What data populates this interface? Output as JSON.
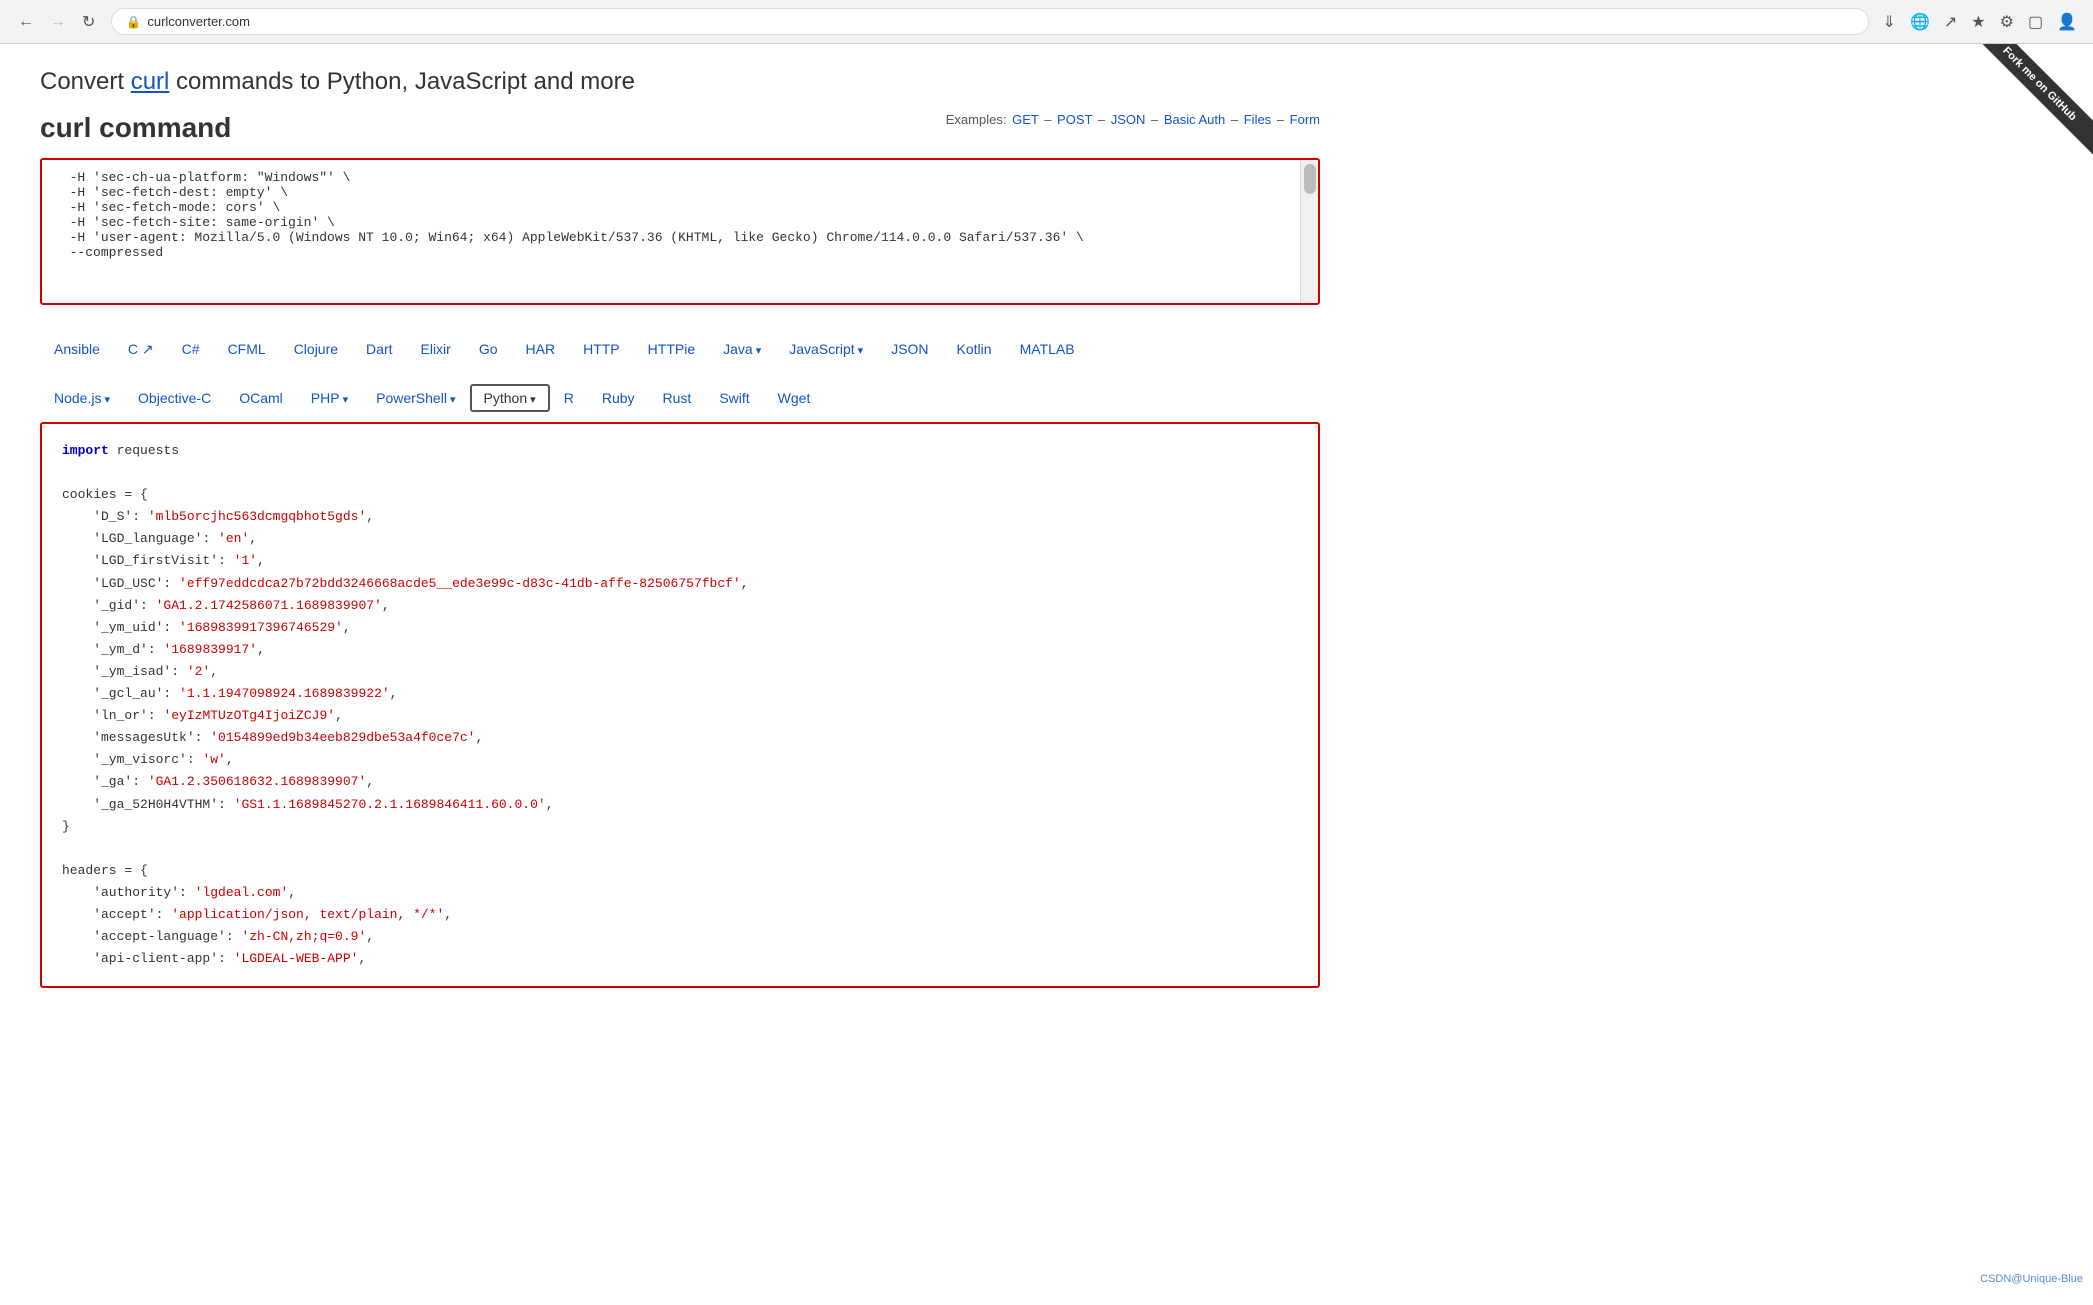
{
  "browser": {
    "url": "curlconverter.com",
    "back_disabled": false,
    "forward_disabled": true
  },
  "page": {
    "title_prefix": "Convert ",
    "title_link": "curl",
    "title_suffix": " commands to Python, JavaScript and more",
    "section_label": "curl command",
    "examples_label": "Examples:",
    "examples_links": [
      "GET",
      "POST",
      "JSON",
      "Basic Auth",
      "Files",
      "Form"
    ],
    "examples_separator": " – "
  },
  "curl_input": {
    "content": "  -H 'sec-ch-ua-platform: \"Windows\"' \\\n  -H 'sec-fetch-dest: empty' \\\n  -H 'sec-fetch-mode: cors' \\\n  -H 'sec-fetch-site: same-origin' \\\n  -H 'user-agent: Mozilla/5.0 (Windows NT 10.0; Win64; x64) AppleWebKit/537.36 (KHTML, like Gecko) Chrome/114.0.0.0 Safari/537.36' \\\n  --compressed"
  },
  "languages": {
    "row1": [
      {
        "label": "Ansible",
        "id": "ansible"
      },
      {
        "label": "C",
        "id": "c",
        "ext": true
      },
      {
        "label": "C#",
        "id": "csharp"
      },
      {
        "label": "CFML",
        "id": "cfml"
      },
      {
        "label": "Clojure",
        "id": "clojure"
      },
      {
        "label": "Dart",
        "id": "dart"
      },
      {
        "label": "Elixir",
        "id": "elixir"
      },
      {
        "label": "Go",
        "id": "go"
      },
      {
        "label": "HAR",
        "id": "har"
      },
      {
        "label": "HTTP",
        "id": "http"
      },
      {
        "label": "HTTPie",
        "id": "httpie"
      },
      {
        "label": "Java",
        "id": "java",
        "dropdown": true
      },
      {
        "label": "JavaScript",
        "id": "javascript",
        "dropdown": true
      },
      {
        "label": "JSON",
        "id": "json"
      },
      {
        "label": "Kotlin",
        "id": "kotlin"
      },
      {
        "label": "MATLAB",
        "id": "matlab"
      }
    ],
    "row2": [
      {
        "label": "Node.js",
        "id": "nodejs",
        "dropdown": true
      },
      {
        "label": "Objective-C",
        "id": "objc"
      },
      {
        "label": "OCaml",
        "id": "ocaml"
      },
      {
        "label": "PHP",
        "id": "php",
        "dropdown": true
      },
      {
        "label": "PowerShell",
        "id": "powershell",
        "dropdown": true
      },
      {
        "label": "Python",
        "id": "python",
        "dropdown": true,
        "active": true
      },
      {
        "label": "R",
        "id": "r"
      },
      {
        "label": "Ruby",
        "id": "ruby"
      },
      {
        "label": "Rust",
        "id": "rust"
      },
      {
        "label": "Swift",
        "id": "swift"
      },
      {
        "label": "Wget",
        "id": "wget"
      }
    ]
  },
  "output": {
    "lines": [
      {
        "type": "code",
        "content": "import requests",
        "parts": [
          {
            "text": "import",
            "cls": "kw"
          },
          {
            "text": " requests",
            "cls": "var"
          }
        ]
      },
      {
        "type": "blank"
      },
      {
        "type": "code",
        "content": "cookies = {",
        "parts": [
          {
            "text": "cookies",
            "cls": "var"
          },
          {
            "text": " = {",
            "cls": "punct"
          }
        ]
      },
      {
        "type": "code",
        "indent": 4,
        "content": "    'D_S': 'mlb5orcjhc563dcmgqbhot5gds',",
        "parts": [
          {
            "text": "    'D_S'",
            "cls": "key"
          },
          {
            "text": ": ",
            "cls": "punct"
          },
          {
            "text": "'mlb5orcjhc563dcmgqbhot5gds'",
            "cls": "str"
          },
          {
            "text": ",",
            "cls": "punct"
          }
        ]
      },
      {
        "type": "code",
        "indent": 4,
        "content": "    'LGD_language': 'en',",
        "parts": [
          {
            "text": "    'LGD_language'",
            "cls": "key"
          },
          {
            "text": ": ",
            "cls": "punct"
          },
          {
            "text": "'en'",
            "cls": "str"
          },
          {
            "text": ",",
            "cls": "punct"
          }
        ]
      },
      {
        "type": "code",
        "indent": 4,
        "content": "    'LGD_firstVisit': '1',",
        "parts": [
          {
            "text": "    'LGD_firstVisit'",
            "cls": "key"
          },
          {
            "text": ": ",
            "cls": "punct"
          },
          {
            "text": "'1'",
            "cls": "str"
          },
          {
            "text": ",",
            "cls": "punct"
          }
        ]
      },
      {
        "type": "code",
        "indent": 4,
        "content": "    'LGD_USC': 'eff97eddcdca27b72bdd3246668acde5__ede3e99c-d83c-41db-affe-82506757fbcf',",
        "parts": [
          {
            "text": "    'LGD_USC'",
            "cls": "key"
          },
          {
            "text": ": ",
            "cls": "punct"
          },
          {
            "text": "'eff97eddcdca27b72bdd3246668acde5__ede3e99c-d83c-41db-affe-82506757fbcf'",
            "cls": "str"
          },
          {
            "text": ",",
            "cls": "punct"
          }
        ]
      },
      {
        "type": "code",
        "indent": 4,
        "content": "    '_gid': 'GA1.2.1742586071.1689839907',",
        "parts": [
          {
            "text": "    '_gid'",
            "cls": "key"
          },
          {
            "text": ": ",
            "cls": "punct"
          },
          {
            "text": "'GA1.2.1742586071.1689839907'",
            "cls": "str"
          },
          {
            "text": ",",
            "cls": "punct"
          }
        ]
      },
      {
        "type": "code",
        "indent": 4,
        "content": "    '_ym_uid': '1689839917396746529',",
        "parts": [
          {
            "text": "    '_ym_uid'",
            "cls": "key"
          },
          {
            "text": ": ",
            "cls": "punct"
          },
          {
            "text": "'1689839917396746529'",
            "cls": "str"
          },
          {
            "text": ",",
            "cls": "punct"
          }
        ]
      },
      {
        "type": "code",
        "indent": 4,
        "content": "    '_ym_d': '1689839917',",
        "parts": [
          {
            "text": "    '_ym_d'",
            "cls": "key"
          },
          {
            "text": ": ",
            "cls": "punct"
          },
          {
            "text": "'1689839917'",
            "cls": "str"
          },
          {
            "text": ",",
            "cls": "punct"
          }
        ]
      },
      {
        "type": "code",
        "indent": 4,
        "content": "    '_ym_isad': '2',",
        "parts": [
          {
            "text": "    '_ym_isad'",
            "cls": "key"
          },
          {
            "text": ": ",
            "cls": "punct"
          },
          {
            "text": "'2'",
            "cls": "str"
          },
          {
            "text": ",",
            "cls": "punct"
          }
        ]
      },
      {
        "type": "code",
        "indent": 4,
        "content": "    '_gcl_au': '1.1.1947098924.1689839922',",
        "parts": [
          {
            "text": "    '_gcl_au'",
            "cls": "key"
          },
          {
            "text": ": ",
            "cls": "punct"
          },
          {
            "text": "'1.1.1947098924.1689839922'",
            "cls": "str"
          },
          {
            "text": ",",
            "cls": "punct"
          }
        ]
      },
      {
        "type": "code",
        "indent": 4,
        "content": "    'ln_or': 'eyIzMTUzOTg4IjoiZCJ9',",
        "parts": [
          {
            "text": "    'ln_or'",
            "cls": "key"
          },
          {
            "text": ": ",
            "cls": "punct"
          },
          {
            "text": "'eyIzMTUzOTg4IjoiZCJ9'",
            "cls": "str"
          },
          {
            "text": ",",
            "cls": "punct"
          }
        ]
      },
      {
        "type": "code",
        "indent": 4,
        "content": "    'messagesUtk': '0154899ed9b34eeb829dbe53a4f0ce7c',",
        "parts": [
          {
            "text": "    'messagesUtk'",
            "cls": "key"
          },
          {
            "text": ": ",
            "cls": "punct"
          },
          {
            "text": "'0154899ed9b34eeb829dbe53a4f0ce7c'",
            "cls": "str"
          },
          {
            "text": ",",
            "cls": "punct"
          }
        ]
      },
      {
        "type": "code",
        "indent": 4,
        "content": "    '_ym_visorc': 'w',",
        "parts": [
          {
            "text": "    '_ym_visorc'",
            "cls": "key"
          },
          {
            "text": ": ",
            "cls": "punct"
          },
          {
            "text": "'w'",
            "cls": "str"
          },
          {
            "text": ",",
            "cls": "punct"
          }
        ]
      },
      {
        "type": "code",
        "indent": 4,
        "content": "    '_ga': 'GA1.2.350618632.1689839907',",
        "parts": [
          {
            "text": "    '_ga'",
            "cls": "key"
          },
          {
            "text": ": ",
            "cls": "punct"
          },
          {
            "text": "'GA1.2.350618632.1689839907'",
            "cls": "str"
          },
          {
            "text": ",",
            "cls": "punct"
          }
        ]
      },
      {
        "type": "code",
        "indent": 4,
        "content": "    '_ga_52H0H4VTHM': 'GS1.1.1689845270.2.1.1689846411.60.0.0',",
        "parts": [
          {
            "text": "    '_ga_52H0H4VTHM'",
            "cls": "key"
          },
          {
            "text": ": ",
            "cls": "punct"
          },
          {
            "text": "'GS1.1.1689845270.2.1.1689846411.60.0.0'",
            "cls": "str"
          },
          {
            "text": ",",
            "cls": "punct"
          }
        ]
      },
      {
        "type": "code",
        "content": "}",
        "parts": [
          {
            "text": "}",
            "cls": "punct"
          }
        ]
      },
      {
        "type": "blank"
      },
      {
        "type": "code",
        "content": "headers = {",
        "parts": [
          {
            "text": "headers",
            "cls": "var"
          },
          {
            "text": " = {",
            "cls": "punct"
          }
        ]
      },
      {
        "type": "code",
        "indent": 4,
        "content": "    'authority': 'lgdeal.com',",
        "parts": [
          {
            "text": "    'authority'",
            "cls": "key"
          },
          {
            "text": ": ",
            "cls": "punct"
          },
          {
            "text": "'lgdeal.com'",
            "cls": "str"
          },
          {
            "text": ",",
            "cls": "punct"
          }
        ]
      },
      {
        "type": "code",
        "indent": 4,
        "content": "    'accept': 'application/json, text/plain, */*',",
        "parts": [
          {
            "text": "    'accept'",
            "cls": "key"
          },
          {
            "text": ": ",
            "cls": "punct"
          },
          {
            "text": "'application/json, text/plain, */*'",
            "cls": "str"
          },
          {
            "text": ",",
            "cls": "punct"
          }
        ]
      },
      {
        "type": "code",
        "indent": 4,
        "content": "    'accept-language': 'zh-CN,zh;q=0.9',",
        "parts": [
          {
            "text": "    'accept-language'",
            "cls": "key"
          },
          {
            "text": ": ",
            "cls": "punct"
          },
          {
            "text": "'zh-CN,zh;q=0.9'",
            "cls": "str"
          },
          {
            "text": ",",
            "cls": "punct"
          }
        ]
      },
      {
        "type": "code",
        "indent": 4,
        "content": "    'api-client-app': 'LGDEAL-WEB-APP',",
        "parts": [
          {
            "text": "    'api-client-app'",
            "cls": "key"
          },
          {
            "text": ": ",
            "cls": "punct"
          },
          {
            "text": "'LGDEAL-WEB-APP'",
            "cls": "str"
          },
          {
            "text": ",",
            "cls": "punct"
          }
        ]
      }
    ]
  },
  "watermark": {
    "text": "CSDN@Unique-Blue"
  },
  "fork_ribbon": {
    "text": "Fork me on GitHub"
  }
}
